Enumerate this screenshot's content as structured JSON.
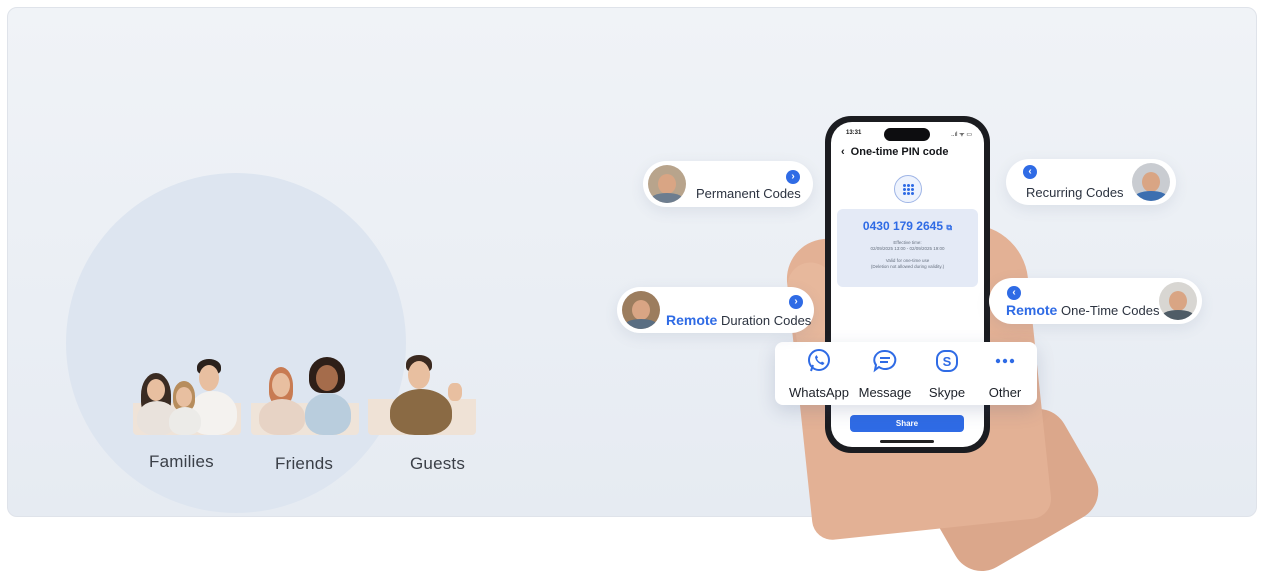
{
  "audience": {
    "groups": [
      {
        "label": "Families"
      },
      {
        "label": "Friends"
      },
      {
        "label": "Guests"
      }
    ]
  },
  "code_types": {
    "permanent": {
      "label": "Permanent Codes"
    },
    "recurring": {
      "label": "Recurring Codes"
    },
    "remote_duration": {
      "highlight": "Remote",
      "label": "Duration Codes"
    },
    "remote_one_time": {
      "highlight": "Remote",
      "label": "One-Time Codes"
    }
  },
  "phone": {
    "status_time": "13:31",
    "status_icons": "..ıl ᯤ ▭",
    "title": "One-time PIN code",
    "code": "0430 179 2645",
    "effective_label": "Effective time:",
    "effective_range": "02/09/2025 13:00 - 02/09/2025 19:00",
    "valid_note": "Valid for one-time use",
    "deletion_note": "(Deletion not allowed during validity.)",
    "share_label": "Share"
  },
  "share_sheet": {
    "apps": [
      {
        "label": "WhatsApp",
        "icon": "whatsapp-icon"
      },
      {
        "label": "Message",
        "icon": "message-icon"
      },
      {
        "label": "Skype",
        "icon": "skype-icon"
      },
      {
        "label": "Other",
        "icon": "more-icon"
      }
    ]
  },
  "colors": {
    "accent": "#2f6be5",
    "background": "#eaeef4",
    "card": "#e4eaf6"
  }
}
